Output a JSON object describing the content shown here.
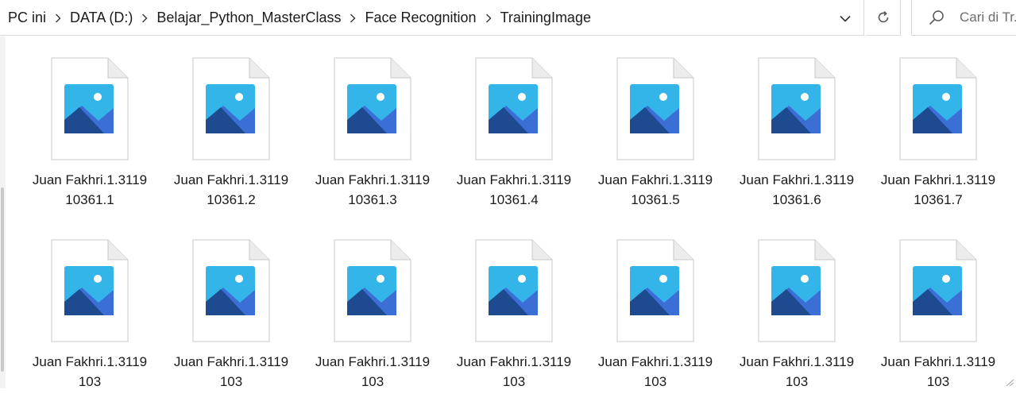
{
  "breadcrumb": {
    "items": [
      "PC ini",
      "DATA (D:)",
      "Belajar_Python_MasterClass",
      "Face Recognition",
      "TrainingImage"
    ]
  },
  "search": {
    "placeholder": "Cari di Tr..."
  },
  "icons": {
    "separator": "chevron-right-icon",
    "dropdown": "chevron-down-icon",
    "refresh": "refresh-icon",
    "search": "search-icon",
    "file": "image-file-icon"
  },
  "colors": {
    "photo_sky": "#33b5ea",
    "photo_mountain_front": "#1e4a8f",
    "photo_mountain_back": "#3c6fd6",
    "page_fold": "#e8e8e8",
    "border": "#d9d9d9"
  },
  "files": [
    {
      "name": "Juan Fakhri.1.311910361.1"
    },
    {
      "name": "Juan Fakhri.1.311910361.2"
    },
    {
      "name": "Juan Fakhri.1.311910361.3"
    },
    {
      "name": "Juan Fakhri.1.311910361.4"
    },
    {
      "name": "Juan Fakhri.1.311910361.5"
    },
    {
      "name": "Juan Fakhri.1.311910361.6"
    },
    {
      "name": "Juan Fakhri.1.311910361.7"
    },
    {
      "name": "Juan Fakhri.1.3119103"
    },
    {
      "name": "Juan Fakhri.1.3119103"
    },
    {
      "name": "Juan Fakhri.1.3119103"
    },
    {
      "name": "Juan Fakhri.1.3119103"
    },
    {
      "name": "Juan Fakhri.1.3119103"
    },
    {
      "name": "Juan Fakhri.1.3119103"
    },
    {
      "name": "Juan Fakhri.1.3119103"
    }
  ]
}
